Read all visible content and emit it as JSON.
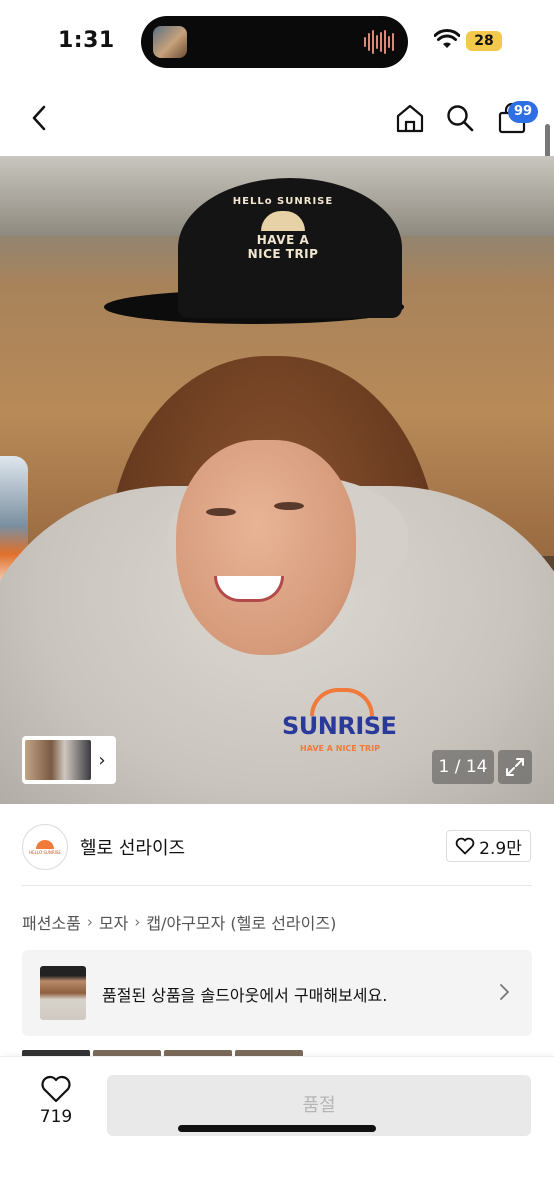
{
  "status_bar": {
    "time": "1:31",
    "battery": "28"
  },
  "nav": {
    "cart_badge": "99"
  },
  "gallery": {
    "counter": "1 / 14"
  },
  "brand": {
    "name": "헬로 선라이즈",
    "likes": "2.9만",
    "logo_text": "HELLO SUNRISE"
  },
  "breadcrumb": [
    "패션소품",
    "모자",
    "캡/야구모자 (헬로 선라이즈)"
  ],
  "soldout_banner": {
    "text": "품절된 상품을 솔드아웃에서 구매해보세요."
  },
  "hero_print": {
    "cap_line1": "HELLo SUNRISE",
    "cap_line2": "HAVE A",
    "cap_line3": "NICE TRIP",
    "hoodie_logo": "SUNRISE",
    "hoodie_sub": "HAVE A NICE TRIP"
  },
  "bottom_bar": {
    "wish_count": "719",
    "buy_label": "품절"
  },
  "colors": {
    "accent_badge": "#2f6fe4",
    "disabled_button": "#e9e9e9"
  },
  "icons": [
    "back-icon",
    "home-icon",
    "search-icon",
    "cart-icon",
    "chevron-right-icon",
    "expand-icon",
    "heart-icon"
  ]
}
